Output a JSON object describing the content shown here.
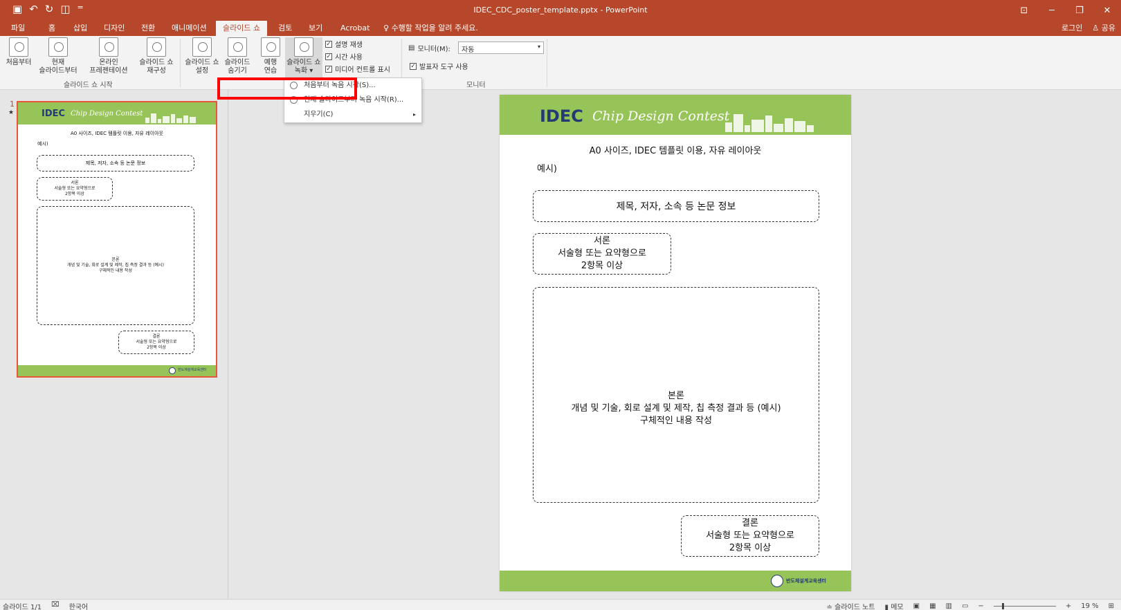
{
  "titlebar": {
    "title": "IDEC_CDC_poster_template.pptx - PowerPoint",
    "qat": [
      "save-icon",
      "undo-icon",
      "redo-icon",
      "start-icon",
      "customize-icon"
    ]
  },
  "tabs": [
    "파일",
    "홈",
    "삽입",
    "디자인",
    "전환",
    "애니메이션",
    "슬라이드 쇼",
    "검토",
    "보기",
    "Acrobat"
  ],
  "active_tab": "슬라이드 쇼",
  "tell_me": "수행할 작업을 알려 주세요.",
  "account": {
    "login": "로그인",
    "share": "공유"
  },
  "ribbon": {
    "btn_from_start": "처음부터",
    "btn_current_1": "현재",
    "btn_current_2": "슬라이드부터",
    "btn_online_1": "온라인",
    "btn_online_2": "프레젠테이션",
    "btn_custom_1": "슬라이드 쇼",
    "btn_custom_2": "재구성",
    "group_start": "슬라이드 쇼 시작",
    "btn_setup_1": "슬라이드 쇼",
    "btn_setup_2": "설정",
    "btn_hide_1": "슬라이드",
    "btn_hide_2": "숨기기",
    "btn_rehearse_1": "예행",
    "btn_rehearse_2": "연습",
    "btn_record_1": "슬라이드 쇼",
    "btn_record_2": "녹화",
    "chk_narration": "설명 재생",
    "chk_timings": "시간 사용",
    "chk_media": "미디어 컨트롤 표시",
    "monitor_label": "모니터(M):",
    "monitor_value": "자동",
    "chk_presenter": "발표자 도구 사용",
    "group_monitor": "모니터"
  },
  "record_menu": {
    "item1": "처음부터 녹음 시작(S)...",
    "item2": "현재 슬라이드부터 녹음 시작(R)...",
    "item3": "지우기(C)"
  },
  "thumbnail": {
    "number": "1",
    "star": "★"
  },
  "slide": {
    "logo": "IDEC",
    "contest": "Chip Design Contest",
    "intro": "A0 사이즈, IDEC 템플릿 이용, 자유 레이아웃",
    "example": "예시)",
    "box_title": "제목, 저자, 소속 등 논문 정보",
    "intro_head": "서론",
    "intro_l1": "서술형 또는 요약형으로",
    "intro_l2": "2항목 이상",
    "body_head": "본론",
    "body_l1": "개념 및 기술, 회로 설계 및 제작, 칩 측정 결과 등 (예시)",
    "body_l2": "구체적인 내용 작성",
    "concl_head": "결론",
    "concl_l1": "서술형 또는 요약형으로",
    "concl_l2": "2항목 이상",
    "footer_org": "반도체설계교육센터"
  },
  "status": {
    "slide_count": "슬라이드 1/1",
    "language": "한국어",
    "notes": "슬라이드 노트",
    "comments": "메모",
    "zoom": "19 %"
  },
  "colors": {
    "accent": "#b7472a",
    "slide_green": "#97c459",
    "logo_blue": "#233a74"
  }
}
